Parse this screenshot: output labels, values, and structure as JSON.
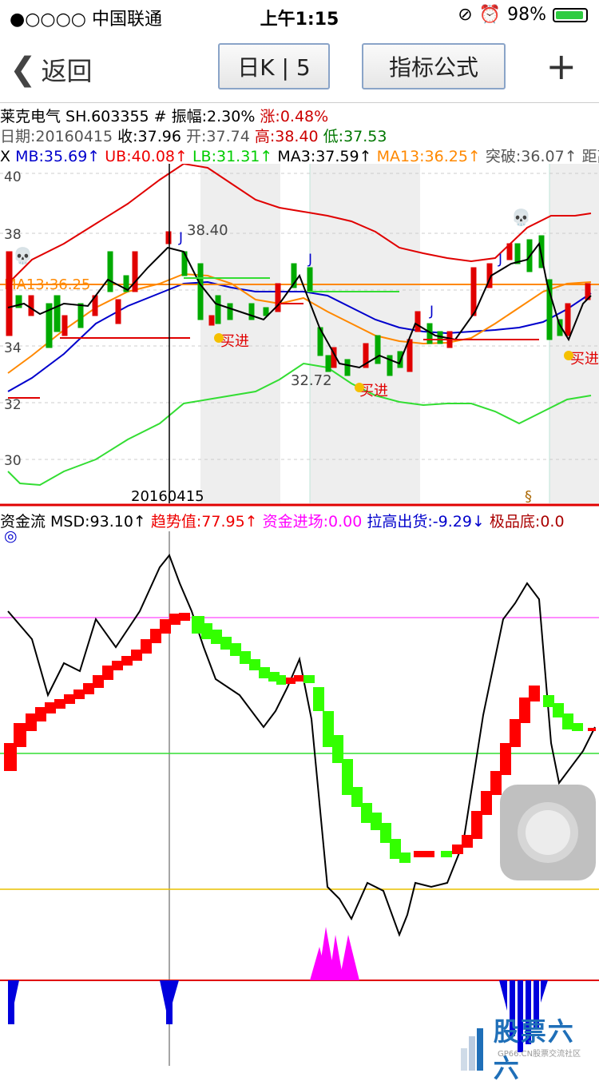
{
  "status": {
    "carrier": "●○○○○ 中国联通",
    "time": "上午1:15",
    "battery": "98%"
  },
  "nav": {
    "back_label": "返回",
    "period_button": "日K | 5",
    "formula_button": "指标公式",
    "add_icon": "plus-icon"
  },
  "stock": {
    "line1": {
      "name": "莱克电气 SH.603355",
      "amp": " # 振幅:2.30%",
      "chg": " 涨:0.48%"
    },
    "line2": {
      "date": "日期:20160415",
      "close": " 收:37.96",
      "open": " 开:37.74",
      "high": " 高:38.40",
      "low": " 低:37.53"
    },
    "line3": {
      "x": "X ",
      "mb": "MB:35.69↑",
      "ub": " UB:40.08↑",
      "lb": " LB:31.31↑",
      "ma3": " MA3:37.59↑",
      "ma13": " MA13:36.25↑",
      "tp": " 突破:36.07↑",
      "dist": " 距高"
    }
  },
  "price_chart": {
    "y_ticks": [
      "40",
      "38",
      "34",
      "32",
      "30"
    ],
    "ma13_label": "MA13:36.25",
    "annotations": {
      "high_label": "38.40",
      "low_label": "32.72",
      "buy1": "买进",
      "buy2": "买进",
      "buy3": "买进",
      "j_mark": "J",
      "date_label": "20160415",
      "section_mark": "§"
    }
  },
  "flow_indicator": {
    "title": "资金流 MSD:93.10↑",
    "trend": " 趋势值:77.95↑",
    "inflow": " 资金进场:0.00",
    "pull": " 拉高出货:-9.29↓",
    "bottom": " 极品底:0.0",
    "circle_icon": "◎"
  },
  "logo": {
    "text": "股票六六",
    "sub": "GP66.CN股票交流社区"
  },
  "colors": {
    "red": "#e00000",
    "green": "#00cc00",
    "blue": "#0000cc",
    "orange": "#ff8800",
    "magenta": "#ff00ff",
    "yellow": "#e8c000"
  }
}
